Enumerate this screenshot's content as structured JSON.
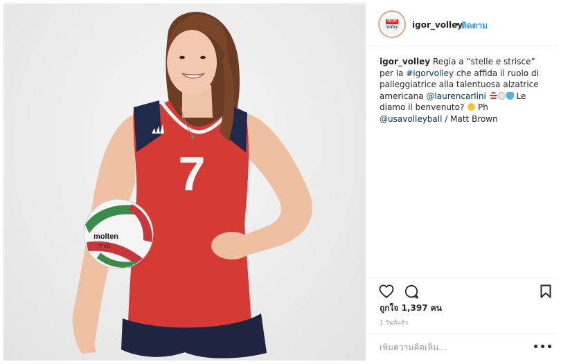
{
  "post": {
    "username": "igor_volley",
    "separator": "•",
    "follow_label": "ติดตาม",
    "avatar": {
      "badge": "GOR",
      "word": "Volley"
    },
    "caption": {
      "username": "igor_volley",
      "part1": " Regia a “stelle e strisce” per la ",
      "hashtag": "#igorvolley",
      "part2": " che affida il ruolo di palleggiatrice alla talentuosa alzatrice americana ",
      "mention1": "@laurencarlini",
      "part3": " Le diamo il benvenuto? ",
      "part4": " Ph ",
      "mention2": "@usavolleyball",
      "part5": " / Matt Brown"
    },
    "likes_text": "ถูกใจ 1,397 คน",
    "time_text": "1 วันที่แล้ว",
    "comment_placeholder": "เพิ่มความคิดเห็น...",
    "more_label": "•••",
    "icons": [
      "heart-icon",
      "comment-icon",
      "bookmark-icon",
      "more-options-icon"
    ]
  },
  "photo": {
    "jersey_number": "7",
    "ball_brand": "molten",
    "ball_model": "FIVB",
    "colors": {
      "jersey": "#d63a35",
      "shorts": "#1f2540",
      "background": "#ececec"
    }
  }
}
